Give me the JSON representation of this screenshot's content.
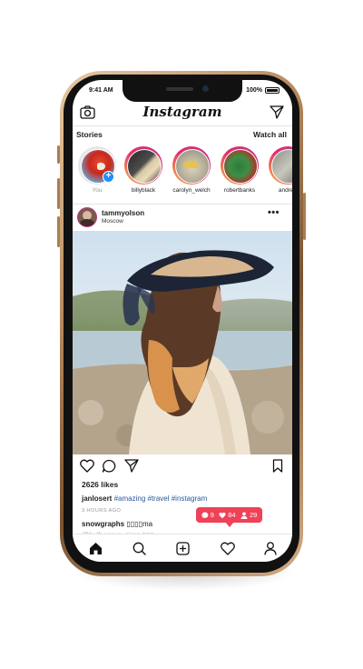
{
  "status_bar": {
    "time": "9:41 AM",
    "battery": "100%"
  },
  "header": {
    "logo": "Instagram",
    "camera_icon": "camera-icon",
    "direct_icon": "paper-plane-icon"
  },
  "stories": {
    "title": "Stories",
    "watch_all": "Watch all",
    "items": [
      {
        "name": "You",
        "own": true
      },
      {
        "name": "billyblack"
      },
      {
        "name": "carolyn_welch"
      },
      {
        "name": "robertbanks"
      },
      {
        "name": "andrea"
      }
    ]
  },
  "post": {
    "username": "tammyolson",
    "location": "Moscow",
    "more": "•••",
    "likes": "2626 likes",
    "caption_user": "janlosert",
    "caption_tags": "#amazing #travel #instagram",
    "time_ago": "3 HOURS AGO",
    "comment_user": "snowgraphs",
    "comment_text": "▯▯▯▯ma",
    "comment2": "@bulbasaur_sims ▯▯▯"
  },
  "notification": {
    "comments": "9",
    "likes": "84",
    "followers": "29"
  },
  "bottom_nav": {
    "items": [
      "home-icon",
      "search-icon",
      "add-post-icon",
      "heart-icon",
      "profile-icon"
    ]
  },
  "colors": {
    "accent": "#f04158",
    "story_ring": "#e1306c",
    "plus": "#1e90ff",
    "tag": "#2a5a9a"
  }
}
